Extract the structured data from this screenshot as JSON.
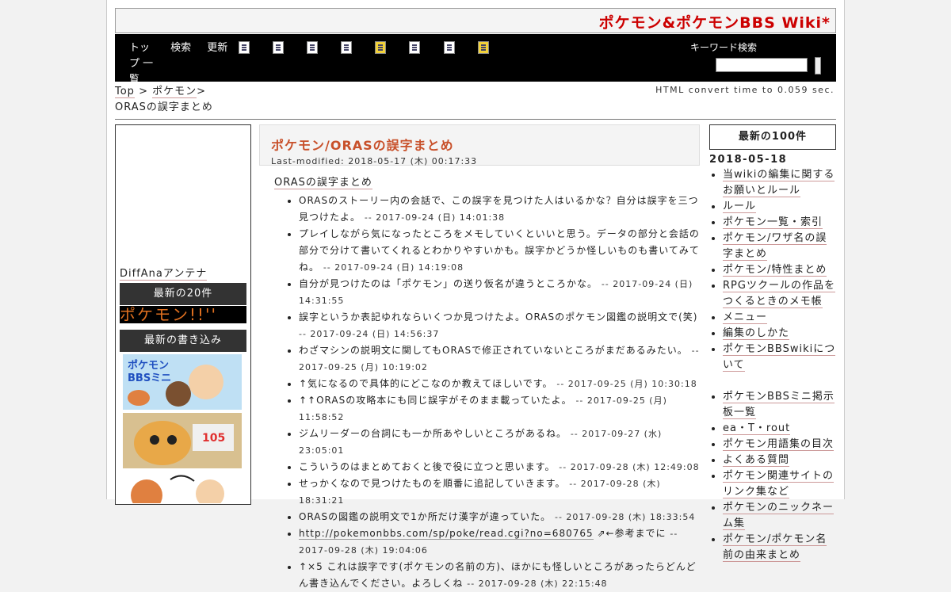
{
  "site": {
    "title": "ポケモン&ポケモンBBS Wiki*"
  },
  "nav": {
    "menu": [
      "トップ 一覧",
      "検索",
      "更新"
    ],
    "tools": [
      "edit-icon",
      "copy-icon",
      "diff-icon",
      "backup-icon",
      "freeze-icon",
      "rename-icon",
      "new-icon",
      "help-icon"
    ],
    "search_label": "キーワード検索"
  },
  "breadcrumb": {
    "top": "Top",
    "sep": ">",
    "parent": "ポケモン",
    "sep2": ">",
    "page": "ORASの誤字まとめ"
  },
  "convert_time": "HTML convert time to 0.059 sec.",
  "left": {
    "diffana": "DiffAnaアンテナ",
    "box1": "最新の20件",
    "ticker": "ポケモン!!''",
    "box2": "最新の書き込み"
  },
  "main": {
    "title": "ポケモン/ORASの誤字まとめ",
    "modified": "Last-modified: 2018-05-17 (木) 00:17:33",
    "section": "ORASの誤字まとめ",
    "items": [
      {
        "text": "ORASのストーリー内の会話で、この誤字を見つけた人はいるかな？自分は誤字を三つ見つけたよ。",
        "ts": "-- 2017-09-24 (日) 14:01:38"
      },
      {
        "text": "プレイしながら気になったところをメモしていくといいと思う。データの部分と会話の部分で分けて書いてくれるとわかりやすいかも。誤字かどうか怪しいものも書いてみてね。",
        "ts": "-- 2017-09-24 (日) 14:19:08"
      },
      {
        "text": "自分が見つけたのは「ポケモン」の送り仮名が違うところかな。",
        "ts": "-- 2017-09-24 (日) 14:31:55"
      },
      {
        "text": "誤字というか表記ゆれならいくつか見つけたよ。ORASのポケモン図鑑の説明文で(笑)",
        "ts": "-- 2017-09-24 (日) 14:56:37"
      },
      {
        "text": "わざマシンの説明文に関してもORASで修正されていないところがまだあるみたい。",
        "ts": "-- 2017-09-25 (月) 10:19:02"
      },
      {
        "text": "↑気になるので具体的にどこなのか教えてほしいです。",
        "ts": "-- 2017-09-25 (月) 10:30:18"
      },
      {
        "text": "↑↑ORASの攻略本にも同じ誤字がそのまま載っていたよ。",
        "ts": "-- 2017-09-25 (月) 11:58:52"
      },
      {
        "text": "ジムリーダーの台詞にも一か所あやしいところがあるね。",
        "ts": "-- 2017-09-27 (水) 23:05:01"
      },
      {
        "text": "こういうのはまとめておくと後で役に立つと思います。",
        "ts": "-- 2017-09-28 (木) 12:49:08"
      },
      {
        "text": "せっかくなので見つけたものを順番に追記していきます。",
        "ts": "-- 2017-09-28 (木) 18:31:21"
      },
      {
        "text": "ORASの図鑑の説明文で1か所だけ漢字が違っていた。",
        "ts": "-- 2017-09-28 (木) 18:33:54"
      },
      {
        "link": "http://pokemonbbs.com/sp/poke/read.cgi?no=680765",
        "text": "←参考までに",
        "ts": "-- 2017-09-28 (木) 19:04:06"
      },
      {
        "text": "↑×5 これは誤字です(ポケモンの名前の方)、ほかにも怪しいところがあったらどんどん書き込んでください。よろしくね",
        "ts": "-- 2017-09-28 (木) 22:15:48"
      }
    ]
  },
  "right": {
    "head": "最新の100件",
    "date": "2018-05-18",
    "items": [
      "当wikiの編集に関するお願いとルール",
      "ルール",
      "ポケモン一覧・索引",
      "ポケモン/ワザ名の誤字まとめ",
      "ポケモン/特性まとめ",
      "RPGツクールの作品をつくるときのメモ帳",
      "メニュー",
      "編集のしかた",
      "ポケモンBBSwikiについて"
    ],
    "items2": [
      "ポケモンBBSミニ掲示板一覧",
      "ea・T・rout",
      "ポケモン用語集の目次",
      "よくある質問",
      "ポケモン関連サイトのリンク集など",
      "ポケモンのニックネーム集",
      "ポケモン/ポケモン名前の由来まとめ"
    ]
  }
}
